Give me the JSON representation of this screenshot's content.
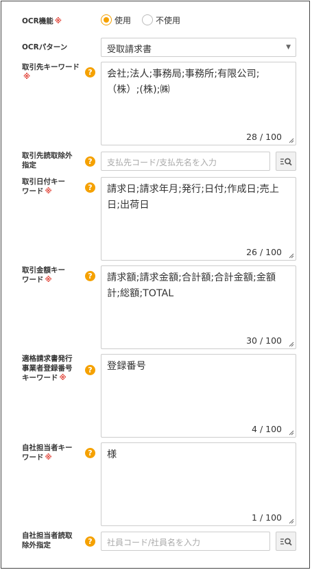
{
  "required_mark": "※",
  "ocr": {
    "label": "OCR機能",
    "options": [
      {
        "label": "使用",
        "selected": true
      },
      {
        "label": "不使用",
        "selected": false
      }
    ]
  },
  "pattern": {
    "label": "OCRパターン",
    "value": "受取請求書",
    "caret": "▼"
  },
  "fields": [
    {
      "label": "取引先キーワード",
      "value": "会社;法人;事務局;事務所;有限公司;\n（株）;(株);㈱",
      "count": "28 / 100"
    },
    {
      "label": "取引先読取除外\n指定",
      "placeholder": "支払先コード/支払先名を入力"
    },
    {
      "label": "取引日付キー\nワード",
      "value": "請求日;請求年月;発行;日付;作成日;売上\n日;出荷日",
      "count": "26 / 100"
    },
    {
      "label": "取引金額キー\nワード",
      "value": "請求額;請求金額;合計額;合計金額;金額\n計;総額;TOTAL",
      "count": "30 / 100"
    },
    {
      "label": "適格請求書発行\n事業者登録番号\nキーワード",
      "value": "登録番号",
      "count": "4 / 100"
    },
    {
      "label": "自社担当者キー\nワード",
      "value": "様",
      "count": "1 / 100"
    },
    {
      "label": "自社担当者読取\n除外指定",
      "placeholder": "社員コード/社員名を入力"
    }
  ],
  "help_glyph": "?",
  "colors": {
    "accent": "#f5a100",
    "required": "#e2453a",
    "border": "#cccccc"
  },
  "icons": {
    "help": "question-circle-icon",
    "search": "list-search-icon",
    "resize": "resize-grip-icon"
  }
}
